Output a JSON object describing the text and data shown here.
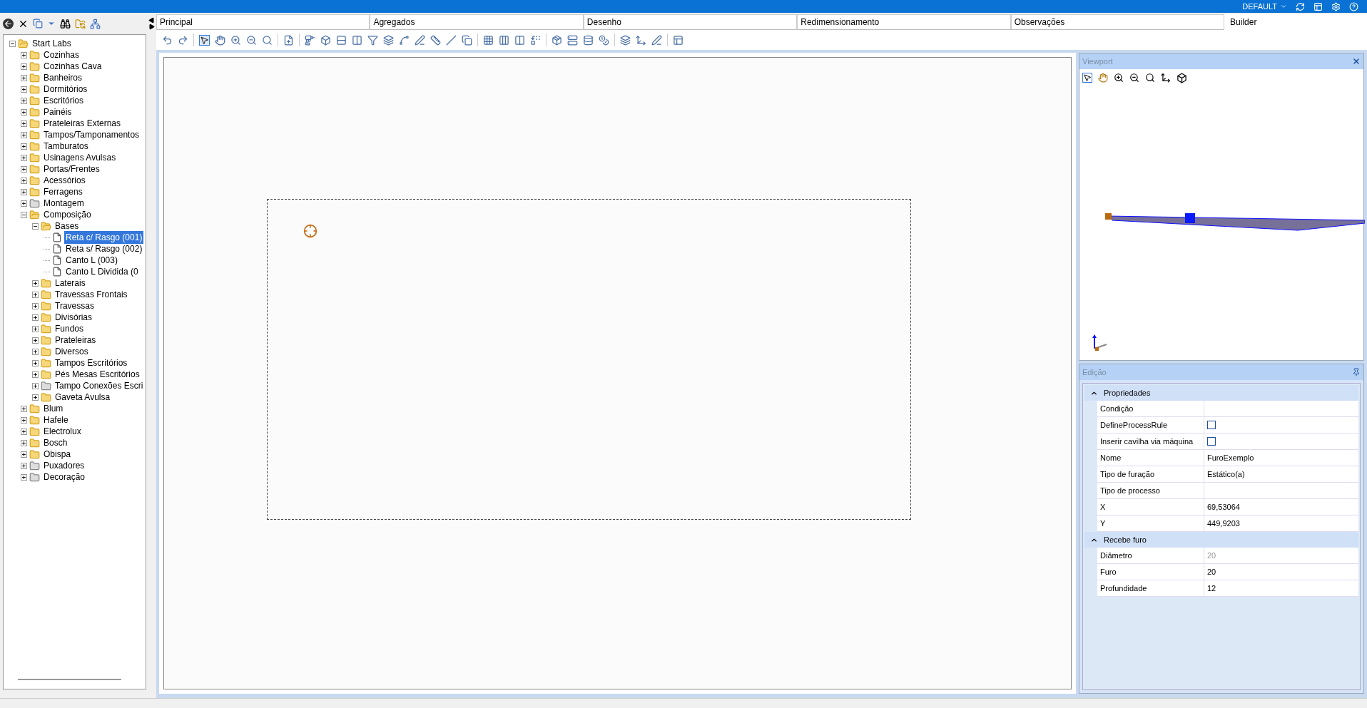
{
  "top_bar": {
    "profile": "DEFAULT"
  },
  "tabs": [
    {
      "label": "Principal",
      "selected": false
    },
    {
      "label": "Agregados",
      "selected": false
    },
    {
      "label": "Desenho",
      "selected": false
    },
    {
      "label": "Redimensionamento",
      "selected": false
    },
    {
      "label": "Observações",
      "selected": false
    },
    {
      "label": "Builder",
      "selected": true
    }
  ],
  "tree": [
    {
      "label": "Start Labs",
      "kind": "folder",
      "expanded": true,
      "selected": false,
      "children": [
        {
          "label": "Cozinhas",
          "kind": "folder",
          "expanded": false,
          "selected": false
        },
        {
          "label": "Cozinhas Cava",
          "kind": "folder",
          "expanded": false,
          "selected": false
        },
        {
          "label": "Banheiros",
          "kind": "folder",
          "expanded": false,
          "selected": false
        },
        {
          "label": "Dormitórios",
          "kind": "folder",
          "expanded": false,
          "selected": false
        },
        {
          "label": "Escritórios",
          "kind": "folder",
          "expanded": false,
          "selected": false
        },
        {
          "label": "Painéis",
          "kind": "folder",
          "expanded": false,
          "selected": false
        },
        {
          "label": "Prateleiras Externas",
          "kind": "folder",
          "expanded": false,
          "selected": false
        },
        {
          "label": "Tampos/Tamponamentos",
          "kind": "folder",
          "expanded": false,
          "selected": false
        },
        {
          "label": "Tamburatos",
          "kind": "folder",
          "expanded": false,
          "selected": false
        },
        {
          "label": "Usinagens Avulsas",
          "kind": "folder",
          "expanded": false,
          "selected": false
        },
        {
          "label": "Portas/Frentes",
          "kind": "folder",
          "expanded": false,
          "selected": false
        },
        {
          "label": "Acessórios",
          "kind": "folder",
          "expanded": false,
          "selected": false
        },
        {
          "label": "Ferragens",
          "kind": "folder",
          "expanded": false,
          "selected": false
        },
        {
          "label": "Montagem",
          "kind": "grayfolder",
          "expanded": false,
          "selected": false
        },
        {
          "label": "Composição",
          "kind": "folder",
          "expanded": true,
          "selected": false,
          "children": [
            {
              "label": "Bases",
              "kind": "folder",
              "expanded": true,
              "selected": false,
              "children": [
                {
                  "label": "Reta c/ Rasgo (001)",
                  "kind": "item",
                  "selected": true
                },
                {
                  "label": "Reta s/ Rasgo (002)",
                  "kind": "item",
                  "selected": false
                },
                {
                  "label": "Canto L (003)",
                  "kind": "item",
                  "selected": false
                },
                {
                  "label": "Canto L Dividida (0",
                  "kind": "item",
                  "selected": false
                }
              ]
            },
            {
              "label": "Laterais",
              "kind": "folder",
              "expanded": false,
              "selected": false
            },
            {
              "label": "Travessas Frontais",
              "kind": "folder",
              "expanded": false,
              "selected": false
            },
            {
              "label": "Travessas",
              "kind": "folder",
              "expanded": false,
              "selected": false
            },
            {
              "label": "Divisórias",
              "kind": "folder",
              "expanded": false,
              "selected": false
            },
            {
              "label": "Fundos",
              "kind": "folder",
              "expanded": false,
              "selected": false
            },
            {
              "label": "Prateleiras",
              "kind": "folder",
              "expanded": false,
              "selected": false
            },
            {
              "label": "Diversos",
              "kind": "folder",
              "expanded": false,
              "selected": false
            },
            {
              "label": "Tampos Escritórios",
              "kind": "folder",
              "expanded": false,
              "selected": false
            },
            {
              "label": "Pés Mesas Escritórios",
              "kind": "folder",
              "expanded": false,
              "selected": false
            },
            {
              "label": "Tampo Conexões Escri",
              "kind": "grayfolder",
              "expanded": false,
              "selected": false
            },
            {
              "label": "Gaveta Avulsa",
              "kind": "folder",
              "expanded": false,
              "selected": false
            }
          ]
        },
        {
          "label": "Blum",
          "kind": "folder",
          "expanded": false,
          "selected": false
        },
        {
          "label": "Hafele",
          "kind": "folder",
          "expanded": false,
          "selected": false
        },
        {
          "label": "Electrolux",
          "kind": "folder",
          "expanded": false,
          "selected": false
        },
        {
          "label": "Bosch",
          "kind": "folder",
          "expanded": false,
          "selected": false
        },
        {
          "label": "Obispa",
          "kind": "folder",
          "expanded": false,
          "selected": false
        },
        {
          "label": "Puxadores",
          "kind": "grayfolder",
          "expanded": false,
          "selected": false
        },
        {
          "label": "Decoração",
          "kind": "grayfolder",
          "expanded": false,
          "selected": false
        }
      ]
    }
  ],
  "viewport": {
    "title": "Viewport"
  },
  "editing": {
    "title": "Edição",
    "sections": [
      {
        "title": "Propriedades",
        "expanded": true,
        "rows": [
          {
            "name": "Condição",
            "kind": "text",
            "value": ""
          },
          {
            "name": "DefineProcessRule",
            "kind": "checkbox",
            "checked": false
          },
          {
            "name": "Inserir cavilha via máquina",
            "kind": "checkbox",
            "checked": false
          },
          {
            "name": "Nome",
            "kind": "text",
            "value": "FuroExemplo"
          },
          {
            "name": "Tipo de furação",
            "kind": "text",
            "value": "Estático(a)"
          },
          {
            "name": "Tipo de processo",
            "kind": "text",
            "value": ""
          },
          {
            "name": "X",
            "kind": "text",
            "value": "69,53064"
          },
          {
            "name": "Y",
            "kind": "text",
            "value": "449,9203"
          }
        ]
      },
      {
        "title": "Recebe furo",
        "expanded": true,
        "rows": [
          {
            "name": "Diâmetro",
            "kind": "text",
            "value": "20",
            "disabled": true
          },
          {
            "name": "Furo",
            "kind": "text",
            "value": "20",
            "disabled": false
          },
          {
            "name": "Profundidade",
            "kind": "text",
            "value": "12",
            "disabled": false
          }
        ]
      }
    ]
  }
}
